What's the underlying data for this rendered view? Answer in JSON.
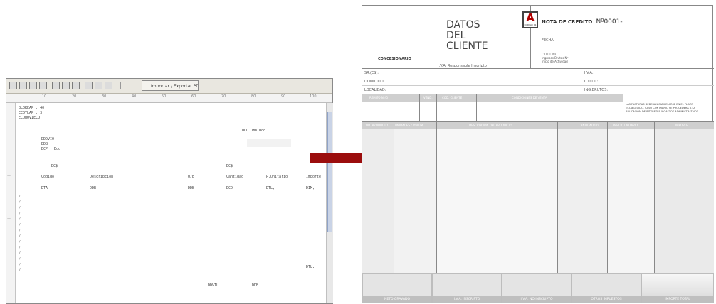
{
  "editor": {
    "toolbar_button_label": "Importar / Exportar PDF",
    "ruler_ticks": [
      "10",
      "20",
      "30",
      "40",
      "50",
      "60",
      "70",
      "80",
      "90",
      "100"
    ],
    "lines": {
      "l1": "BLOKEAP : 40",
      "l2": "ECOTLAP : 3",
      "l3": "ECOMOVIECO",
      "l4": "DDD DMB  Ddd",
      "l5": "DDDVIO",
      "l6": "DDB",
      "l7": "DCP  :  Ddd",
      "l8": "DC$",
      "l9": "DC$",
      "h1": "Codigo",
      "h2": "Descripcion",
      "h3": "U/B",
      "h4": "Cantidad",
      "h5": "P.Unitario",
      "h6": "Importe",
      "r1": "DTA",
      "r2": "DDB",
      "r3": "DDB",
      "r4": "DCD",
      "r5": "DTL,",
      "r6": "DIM,",
      "t1": "DTL,",
      "t2": "DDVTL",
      "t3": "DDB"
    }
  },
  "invoice": {
    "title_lines": [
      "DATOS",
      "DEL",
      "CLIENTE"
    ],
    "concesionario": "CONCESIONARIO",
    "iva_responsable": "I.V.A. Responsable Inscripto",
    "letter": "A",
    "letter_sub": "CODIGO 01",
    "nota_label": "NOTA DE CREDITO",
    "nota_number": "Nº0001-",
    "fecha": "FECHA:",
    "cuit_info": [
      "C.U.I.T. Nº",
      "Ingresos Brutos Nº",
      "Inicio de Actividad"
    ],
    "client_fields_left": [
      "SR.(ES):",
      "DOMICILIO:",
      "LOCALIDAD:"
    ],
    "client_fields_right": [
      "I.V.A.:",
      "C.U.I.T.:",
      "ING.BRUTOS:"
    ],
    "condition_headers": [
      "REMITO Nº/O",
      "VEND.",
      "COD. CLIENTE",
      "CONDICIONES DE VENTA"
    ],
    "notice": "LAS FACTURAS DEBERAN CANCELARSE EN EL PLAZO ESTABLECIDO, CASO CONTRARIO SE PROCEDERA A LA APLICACION DE INTERESES Y GASTOS ADMINISTRATIVOS",
    "item_headers": [
      "COD. PRODUCTO",
      "UNIDADES / VOLUM.",
      "DESCRIPCION DEL PRODUCTO",
      "CANTIDAD/LTS",
      "PRECIO UNITARIO",
      "IMPORTE"
    ],
    "totals_labels": [
      "NETO GRAVADO",
      "I.V.A. INSCRIPTO",
      "I.V.A. NO INSCRIPTO",
      "OTROS IMPUESTOS",
      "IMPORTE TOTAL"
    ],
    "colors": {
      "header_bg": "#cfcfcf",
      "letter_border": "#444444",
      "accent": "#b00000"
    }
  },
  "arrow_color": "#9b0d0d"
}
